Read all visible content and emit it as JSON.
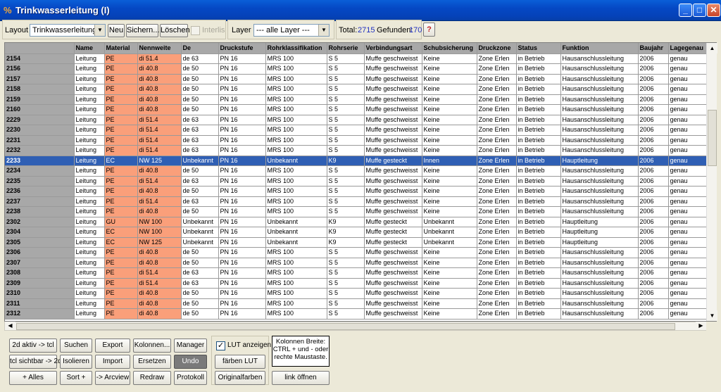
{
  "window": {
    "title": "Trinkwasserleitung (I)",
    "minimize": "_",
    "maximize": "□",
    "close": "✕"
  },
  "toolbar": {
    "layout_label": "Layout",
    "layout_value": "Trinkwasserleitung",
    "neu": "Neu",
    "sichern": "Sichern...",
    "loeschen": "Löschen",
    "interlis": "Interlis",
    "layer_label": "Layer",
    "layer_value": "--- alle Layer ---",
    "total_label": "Total:",
    "total_value": "2715",
    "gefunden_label": "Gefunden:",
    "gefunden_value": "170",
    "help": "?"
  },
  "table": {
    "columns": [
      "",
      "Name",
      "Material",
      "Nennweite",
      "De",
      "Druckstufe",
      "Rohrklassifikation",
      "Rohrserie",
      "Verbindungsart",
      "Schubsicherung",
      "Druckzone",
      "Status",
      "Funktion",
      "Baujahr",
      "Lagegenau"
    ],
    "rows": [
      [
        "2154",
        "Leitung",
        "PE",
        "di 51.4",
        "de 63",
        "PN 16",
        "MRS 100",
        "S 5",
        "Muffe geschweisst",
        "Keine",
        "Zone Erlen",
        "in Betrieb",
        "Hausanschlussleitung",
        "2006",
        "genau"
      ],
      [
        "2156",
        "Leitung",
        "PE",
        "di 40.8",
        "de 50",
        "PN 16",
        "MRS 100",
        "S 5",
        "Muffe geschweisst",
        "Keine",
        "Zone Erlen",
        "in Betrieb",
        "Hausanschlussleitung",
        "2006",
        "genau"
      ],
      [
        "2157",
        "Leitung",
        "PE",
        "di 40.8",
        "de 50",
        "PN 16",
        "MRS 100",
        "S 5",
        "Muffe geschweisst",
        "Keine",
        "Zone Erlen",
        "in Betrieb",
        "Hausanschlussleitung",
        "2006",
        "genau"
      ],
      [
        "2158",
        "Leitung",
        "PE",
        "di 40.8",
        "de 50",
        "PN 16",
        "MRS 100",
        "S 5",
        "Muffe geschweisst",
        "Keine",
        "Zone Erlen",
        "in Betrieb",
        "Hausanschlussleitung",
        "2006",
        "genau"
      ],
      [
        "2159",
        "Leitung",
        "PE",
        "di 40.8",
        "de 50",
        "PN 16",
        "MRS 100",
        "S 5",
        "Muffe geschweisst",
        "Keine",
        "Zone Erlen",
        "in Betrieb",
        "Hausanschlussleitung",
        "2006",
        "genau"
      ],
      [
        "2160",
        "Leitung",
        "PE",
        "di 40.8",
        "de 50",
        "PN 16",
        "MRS 100",
        "S 5",
        "Muffe geschweisst",
        "Keine",
        "Zone Erlen",
        "in Betrieb",
        "Hausanschlussleitung",
        "2006",
        "genau"
      ],
      [
        "2229",
        "Leitung",
        "PE",
        "di 51.4",
        "de 63",
        "PN 16",
        "MRS 100",
        "S 5",
        "Muffe geschweisst",
        "Keine",
        "Zone Erlen",
        "in Betrieb",
        "Hausanschlussleitung",
        "2006",
        "genau"
      ],
      [
        "2230",
        "Leitung",
        "PE",
        "di 51.4",
        "de 63",
        "PN 16",
        "MRS 100",
        "S 5",
        "Muffe geschweisst",
        "Keine",
        "Zone Erlen",
        "in Betrieb",
        "Hausanschlussleitung",
        "2006",
        "genau"
      ],
      [
        "2231",
        "Leitung",
        "PE",
        "di 51.4",
        "de 63",
        "PN 16",
        "MRS 100",
        "S 5",
        "Muffe geschweisst",
        "Keine",
        "Zone Erlen",
        "in Betrieb",
        "Hausanschlussleitung",
        "2006",
        "genau"
      ],
      [
        "2232",
        "Leitung",
        "PE",
        "di 51.4",
        "de 63",
        "PN 16",
        "MRS 100",
        "S 5",
        "Muffe geschweisst",
        "Keine",
        "Zone Erlen",
        "in Betrieb",
        "Hausanschlussleitung",
        "2006",
        "genau"
      ],
      [
        "2233",
        "Leitung",
        "EC",
        "NW 125",
        "Unbekannt",
        "PN 16",
        "Unbekannt",
        "K9",
        "Muffe gesteckt",
        "Innen",
        "Zone Erlen",
        "in Betrieb",
        "Hauptleitung",
        "2006",
        "genau"
      ],
      [
        "2234",
        "Leitung",
        "PE",
        "di 40.8",
        "de 50",
        "PN 16",
        "MRS 100",
        "S 5",
        "Muffe geschweisst",
        "Keine",
        "Zone Erlen",
        "in Betrieb",
        "Hausanschlussleitung",
        "2006",
        "genau"
      ],
      [
        "2235",
        "Leitung",
        "PE",
        "di 51.4",
        "de 63",
        "PN 16",
        "MRS 100",
        "S 5",
        "Muffe geschweisst",
        "Keine",
        "Zone Erlen",
        "in Betrieb",
        "Hausanschlussleitung",
        "2006",
        "genau"
      ],
      [
        "2236",
        "Leitung",
        "PE",
        "di 40.8",
        "de 50",
        "PN 16",
        "MRS 100",
        "S 5",
        "Muffe geschweisst",
        "Keine",
        "Zone Erlen",
        "in Betrieb",
        "Hausanschlussleitung",
        "2006",
        "genau"
      ],
      [
        "2237",
        "Leitung",
        "PE",
        "di 51.4",
        "de 63",
        "PN 16",
        "MRS 100",
        "S 5",
        "Muffe geschweisst",
        "Keine",
        "Zone Erlen",
        "in Betrieb",
        "Hausanschlussleitung",
        "2006",
        "genau"
      ],
      [
        "2238",
        "Leitung",
        "PE",
        "di 40.8",
        "de 50",
        "PN 16",
        "MRS 100",
        "S 5",
        "Muffe geschweisst",
        "Keine",
        "Zone Erlen",
        "in Betrieb",
        "Hausanschlussleitung",
        "2006",
        "genau"
      ],
      [
        "2302",
        "Leitung",
        "GU",
        "NW 100",
        "Unbekannt",
        "PN 16",
        "Unbekannt",
        "K9",
        "Muffe gesteckt",
        "Unbekannt",
        "Zone Erlen",
        "in Betrieb",
        "Hauptleitung",
        "2006",
        "genau"
      ],
      [
        "2304",
        "Leitung",
        "EC",
        "NW 100",
        "Unbekannt",
        "PN 16",
        "Unbekannt",
        "K9",
        "Muffe gesteckt",
        "Unbekannt",
        "Zone Erlen",
        "in Betrieb",
        "Hauptleitung",
        "2006",
        "genau"
      ],
      [
        "2305",
        "Leitung",
        "EC",
        "NW 125",
        "Unbekannt",
        "PN 16",
        "Unbekannt",
        "K9",
        "Muffe gesteckt",
        "Unbekannt",
        "Zone Erlen",
        "in Betrieb",
        "Hauptleitung",
        "2006",
        "genau"
      ],
      [
        "2306",
        "Leitung",
        "PE",
        "di 40.8",
        "de 50",
        "PN 16",
        "MRS 100",
        "S 5",
        "Muffe geschweisst",
        "Keine",
        "Zone Erlen",
        "in Betrieb",
        "Hausanschlussleitung",
        "2006",
        "genau"
      ],
      [
        "2307",
        "Leitung",
        "PE",
        "di 40.8",
        "de 50",
        "PN 16",
        "MRS 100",
        "S 5",
        "Muffe geschweisst",
        "Keine",
        "Zone Erlen",
        "in Betrieb",
        "Hausanschlussleitung",
        "2006",
        "genau"
      ],
      [
        "2308",
        "Leitung",
        "PE",
        "di 51.4",
        "de 63",
        "PN 16",
        "MRS 100",
        "S 5",
        "Muffe geschweisst",
        "Keine",
        "Zone Erlen",
        "in Betrieb",
        "Hausanschlussleitung",
        "2006",
        "genau"
      ],
      [
        "2309",
        "Leitung",
        "PE",
        "di 51.4",
        "de 63",
        "PN 16",
        "MRS 100",
        "S 5",
        "Muffe geschweisst",
        "Keine",
        "Zone Erlen",
        "in Betrieb",
        "Hausanschlussleitung",
        "2006",
        "genau"
      ],
      [
        "2310",
        "Leitung",
        "PE",
        "di 40.8",
        "de 50",
        "PN 16",
        "MRS 100",
        "S 5",
        "Muffe geschweisst",
        "Keine",
        "Zone Erlen",
        "in Betrieb",
        "Hausanschlussleitung",
        "2006",
        "genau"
      ],
      [
        "2311",
        "Leitung",
        "PE",
        "di 40.8",
        "de 50",
        "PN 16",
        "MRS 100",
        "S 5",
        "Muffe geschweisst",
        "Keine",
        "Zone Erlen",
        "in Betrieb",
        "Hausanschlussleitung",
        "2006",
        "genau"
      ],
      [
        "2312",
        "Leitung",
        "PE",
        "di 40.8",
        "de 50",
        "PN 16",
        "MRS 100",
        "S 5",
        "Muffe geschweisst",
        "Keine",
        "Zone Erlen",
        "in Betrieb",
        "Hausanschlussleitung",
        "2006",
        "genau"
      ]
    ],
    "selected_row": "2233",
    "highlight_color": "#fa9f7a",
    "selection_color": "#2f5fb4"
  },
  "bottom": {
    "buttons": {
      "aktiv_tcl": "2d aktiv -> tcl",
      "suchen": "Suchen",
      "export": "Export",
      "kolonnen": "Kolonnen...",
      "manager": "Manager",
      "tcl_sichtbar": "tcl sichtbar -> 2d",
      "isolieren": "Isolieren",
      "import": "Import",
      "ersetzen": "Ersetzen",
      "undo": "Undo",
      "alles": "+ Alles",
      "sort": "Sort +",
      "arcview": "-> Arcview",
      "redraw": "Redraw",
      "protokoll": "Protokoll"
    },
    "lut_label": "LUT anzeigen",
    "lut_checked": true,
    "faerben_lut": "färben LUT",
    "originalfarben": "Originalfarben",
    "info": "Kolonnen Breite: CTRL + und - oder rechte Maustaste.",
    "link_oeffnen": "link öffnen"
  }
}
